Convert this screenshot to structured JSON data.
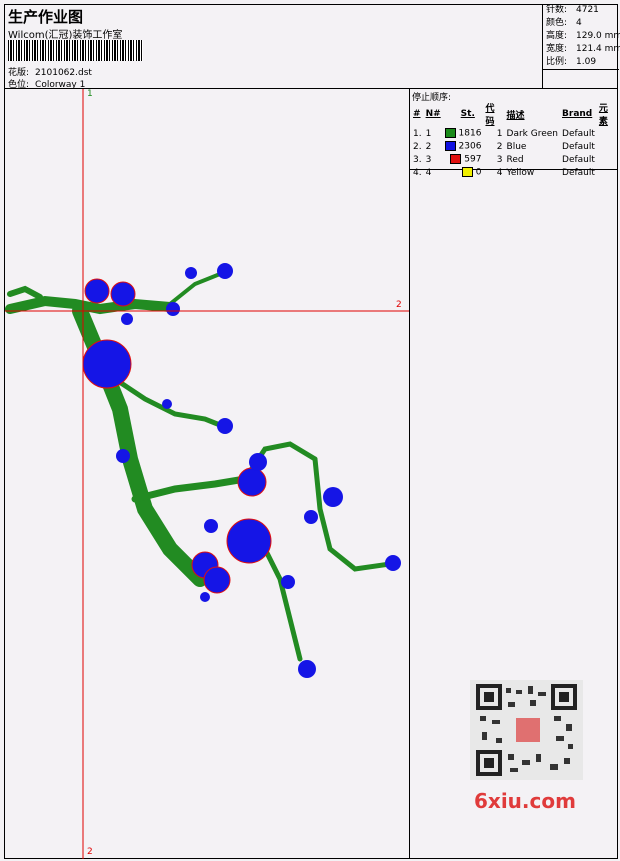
{
  "header": {
    "title": "生产作业图",
    "company": "Wilcom(汇冠)装饰工作室",
    "design_label": "花版:",
    "design_value": "2101062.dst",
    "colorway_label": "色位:",
    "colorway_value": "Colorway 1"
  },
  "specs": [
    {
      "key": "针数:",
      "value": "4721"
    },
    {
      "key": "颜色:",
      "value": "4"
    },
    {
      "key": "高度:",
      "value": "129.0 mm"
    },
    {
      "key": "宽度:",
      "value": "121.4 mm"
    },
    {
      "key": "比例:",
      "value": "1.09"
    }
  ],
  "stop_sequence": {
    "title": "停止顺序:",
    "columns": [
      "#",
      "N#",
      "St.",
      "代码",
      "描述",
      "Brand",
      "元素"
    ],
    "rows": [
      {
        "idx": "1.",
        "n": "1",
        "color": "#1a8a1a",
        "st": "1816",
        "code": "1",
        "desc": "Dark Green",
        "brand": "Default"
      },
      {
        "idx": "2.",
        "n": "2",
        "color": "#1010e0",
        "st": "2306",
        "code": "2",
        "desc": "Blue",
        "brand": "Default"
      },
      {
        "idx": "3.",
        "n": "3",
        "color": "#e01010",
        "st": "597",
        "code": "3",
        "desc": "Red",
        "brand": "Default"
      },
      {
        "idx": "4.",
        "n": "4",
        "color": "#f0f000",
        "st": "0",
        "code": "4",
        "desc": "Yellow",
        "brand": "Default"
      }
    ]
  },
  "axes": {
    "v_top": "1",
    "h_right": "2",
    "v_bottom": "2"
  },
  "watermark": {
    "text": "6xiu.com"
  },
  "colors": {
    "green": "#228b22",
    "blue": "#1515e6",
    "red": "#e01010",
    "axis": "#e00000"
  }
}
